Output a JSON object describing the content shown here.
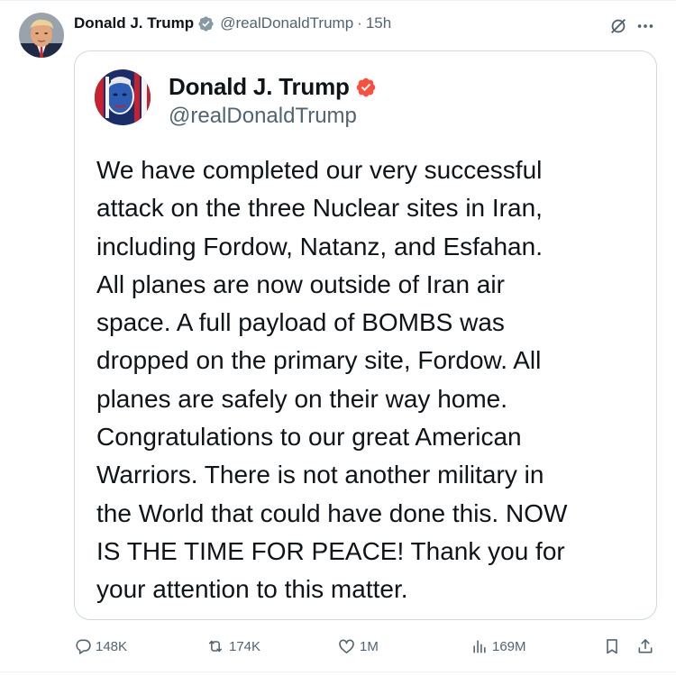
{
  "post": {
    "author_name": "Donald J. Trump",
    "author_handle": "@realDonaldTrump",
    "separator": "·",
    "time": "15h"
  },
  "quote": {
    "author_name": "Donald J. Trump",
    "author_handle": "@realDonaldTrump",
    "text": "We have completed our very successful\nattack on the three Nuclear sites in Iran,\nincluding Fordow, Natanz, and Esfahan.\nAll planes are now outside of Iran air\nspace. A full payload of BOMBS was\ndropped on the primary site, Fordow. All\nplanes are safely on their way home.\nCongratulations to our great American\nWarriors. There is not another military in\nthe World that could have done this. NOW\nIS THE TIME FOR PEACE! Thank you for\nyour attention to this matter."
  },
  "actions": {
    "replies": "148K",
    "reposts": "174K",
    "likes": "1M",
    "views": "169M"
  },
  "icons": {
    "verified_blue": "verified-badge-icon",
    "verified_orange": "truth-verified-badge-icon",
    "grok": "grok-icon",
    "more": "more-icon",
    "reply": "reply-icon",
    "repost": "repost-icon",
    "like": "heart-icon",
    "views": "views-icon",
    "bookmark": "bookmark-icon",
    "share": "share-icon"
  },
  "colors": {
    "text_primary": "#0f1419",
    "text_secondary": "#536471",
    "verified_blue": "#1d9bf0",
    "truth_verified": "#ff4e3d",
    "border": "#cfd9de"
  }
}
